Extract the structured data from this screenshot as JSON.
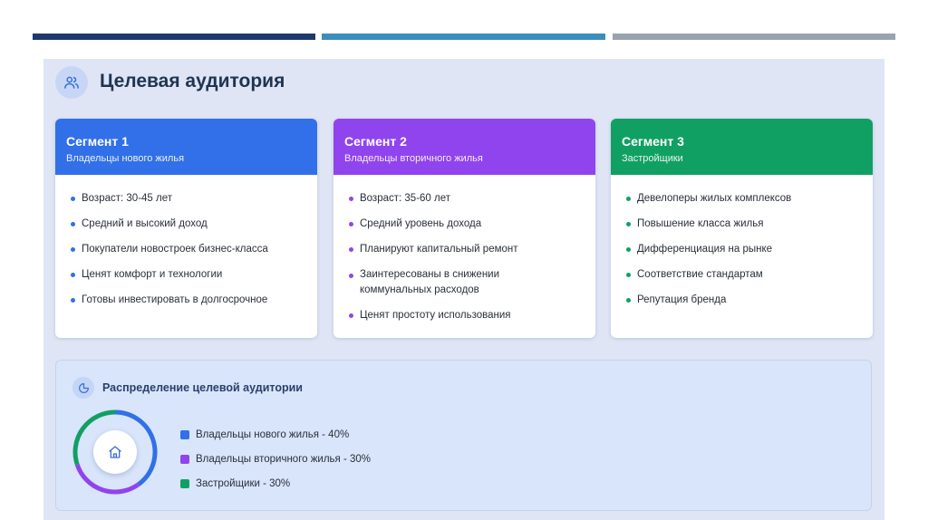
{
  "colors": {
    "segment1": "#3170e8",
    "segment2": "#9044ee",
    "segment3": "#11a063",
    "navy": "#1e3a6b",
    "teal": "#3c8dbc",
    "gray": "#9aa3ad"
  },
  "header": {
    "title": "Целевая аудитория",
    "icon": "users-icon"
  },
  "segments": [
    {
      "title": "Сегмент 1",
      "subtitle": "Владельцы нового жилья",
      "items": [
        "Возраст: 30-45 лет",
        "Средний и высокий доход",
        "Покупатели новостроек бизнес-класса",
        "Ценят комфорт и технологии",
        "Готовы инвестировать в долгосрочное"
      ]
    },
    {
      "title": "Сегмент 2",
      "subtitle": "Владельцы вторичного жилья",
      "items": [
        "Возраст: 35-60 лет",
        "Средний уровень дохода",
        "Планируют капитальный ремонт",
        "Заинтересованы в снижении коммунальных расходов",
        "Ценят простоту использования"
      ]
    },
    {
      "title": "Сегмент 3",
      "subtitle": "Застройщики",
      "items": [
        "Девелоперы жилых комплексов",
        "Повышение класса жилья",
        "Дифференциация на рынке",
        "Соответствие стандартам",
        "Репутация бренда"
      ]
    }
  ],
  "distribution": {
    "title": "Распределение целевой аудитории",
    "icon": "pie-chart-icon",
    "center_icon": "home-icon",
    "legend": [
      "Владельцы нового жилья - 40%",
      "Владельцы вторичного жилья - 30%",
      "Застройщики - 30%"
    ]
  },
  "chart_data": {
    "type": "pie",
    "categories": [
      "Владельцы нового жилья",
      "Владельцы вторичного жилья",
      "Застройщики"
    ],
    "values": [
      40,
      30,
      30
    ],
    "colors": [
      "#3170e8",
      "#9044ee",
      "#11a063"
    ]
  }
}
